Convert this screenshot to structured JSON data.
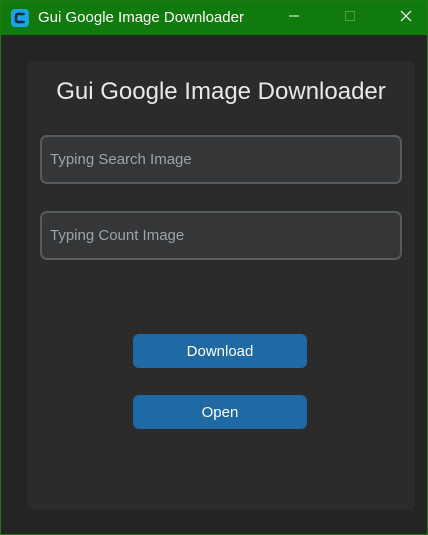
{
  "window": {
    "title": "Gui Google Image Downloader",
    "icon": "customtkinter-logo-icon",
    "controls": [
      "minimize-icon",
      "maximize-icon",
      "close-icon"
    ]
  },
  "main": {
    "heading": "Gui Google Image Downloader",
    "search_input": {
      "value": "",
      "placeholder": "Typing Search Image"
    },
    "count_input": {
      "value": "",
      "placeholder": "Typing Count Image"
    },
    "download_label": "Download",
    "open_label": "Open"
  },
  "colors": {
    "titlebar": "#117a0c",
    "background": "#242424",
    "panel": "#2b2b2b",
    "input_bg": "#343638",
    "input_border": "#565b5e",
    "button": "#1f6aa5",
    "app_icon": "#1aa3e8"
  }
}
